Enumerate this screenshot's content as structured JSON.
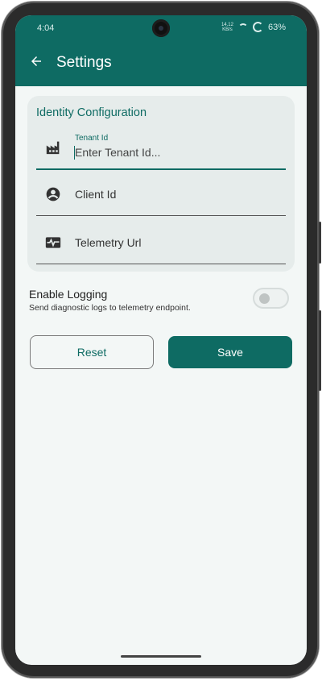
{
  "status_bar": {
    "time": "4:04",
    "network_speed": "14.12\nKB/s",
    "battery": "63%"
  },
  "header": {
    "title": "Settings",
    "back_icon": "arrow-left-icon"
  },
  "identity_card": {
    "title": "Identity Configuration",
    "fields": [
      {
        "icon": "factory-icon",
        "label": "Tenant Id",
        "placeholder": "Enter Tenant Id...",
        "value": ""
      },
      {
        "icon": "account-circle-icon",
        "label": "Client Id",
        "value": ""
      },
      {
        "icon": "monitor-heartbeat-icon",
        "label": "Telemetry Url",
        "value": ""
      }
    ]
  },
  "logging": {
    "title": "Enable Logging",
    "subtitle": "Send diagnostic logs to telemetry endpoint.",
    "enabled": false
  },
  "actions": {
    "reset_label": "Reset",
    "save_label": "Save"
  },
  "colors": {
    "primary": "#0e6b63",
    "background": "#f3f7f6",
    "card": "#e6eceb"
  }
}
